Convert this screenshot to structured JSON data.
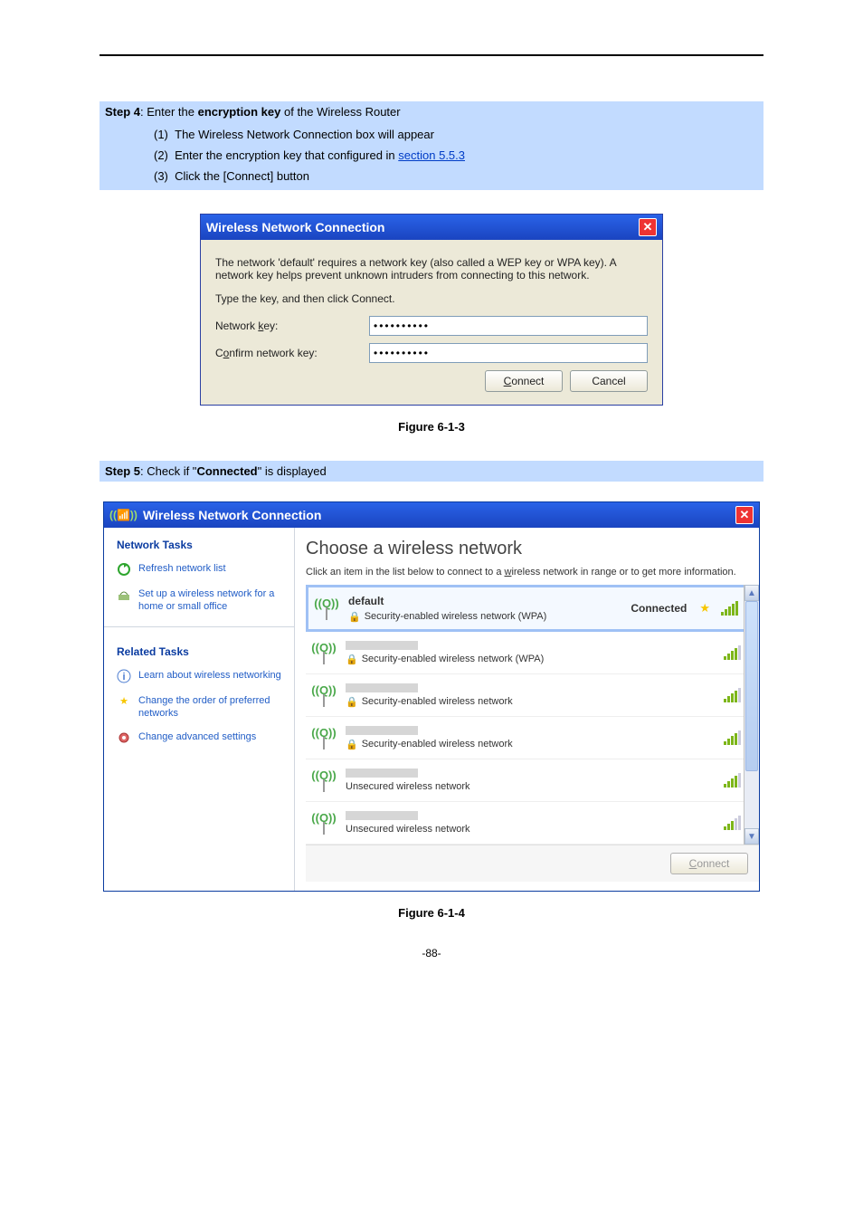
{
  "step4": {
    "label": "Step 4",
    "text_before": ": Enter the ",
    "bold": "encryption key",
    "text_after": " of the Wireless Router",
    "items": [
      {
        "n": "(1)",
        "t": "The Wireless Network Connection box will appear"
      },
      {
        "n": "(2)",
        "t": "Enter the encryption key that configured in ",
        "link": "section 5.5.3"
      },
      {
        "n": "(3)",
        "t": "Click the [Connect] button"
      }
    ]
  },
  "dlg1": {
    "title": "Wireless Network Connection",
    "desc": "The network 'default' requires a network key (also called a WEP key or WPA key). A network key helps prevent unknown intruders from connecting to this network.",
    "instr": "Type the key, and then click Connect.",
    "label_key": "Network key:",
    "label_key_ul": "k",
    "label_confirm": "Confirm network key:",
    "label_confirm_ul": "o",
    "key_value": "••••••••••",
    "confirm_value": "••••••••••",
    "btn_connect": "Connect",
    "btn_connect_ul": "C",
    "btn_cancel": "Cancel"
  },
  "figure1_caption": "Figure 6-1-3",
  "step5": {
    "label": "Step 5",
    "before": ": Check if \"",
    "bold": "Connected",
    "after": "\" is displayed"
  },
  "dlg2": {
    "title": "Wireless Network Connection",
    "sidebar": {
      "sec1": "Network Tasks",
      "tasks1": [
        {
          "icon": "refresh",
          "text": "Refresh network list"
        },
        {
          "icon": "setup",
          "text": "Set up a wireless network for a home or small office"
        }
      ],
      "sec2": "Related Tasks",
      "tasks2": [
        {
          "icon": "info",
          "text": "Learn about wireless networking"
        },
        {
          "icon": "star",
          "text": "Change the order of preferred networks"
        },
        {
          "icon": "gear",
          "text": "Change advanced settings"
        }
      ]
    },
    "heading": "Choose a wireless network",
    "sub_before": "Click an item in the list below to connect to a ",
    "sub_ul": "w",
    "sub_after": "ireless network in range or to get more information.",
    "connected_label": "Connected",
    "networks": [
      {
        "name": "default",
        "security": "Security-enabled wireless network (WPA)",
        "secure": true,
        "signal": 5,
        "connected": true
      },
      {
        "name": "",
        "security": "Security-enabled wireless network (WPA)",
        "secure": true,
        "signal": 4,
        "connected": false
      },
      {
        "name": "",
        "security": "Security-enabled wireless network",
        "secure": true,
        "signal": 4,
        "connected": false
      },
      {
        "name": "",
        "security": "Security-enabled wireless network",
        "secure": true,
        "signal": 4,
        "connected": false
      },
      {
        "name": "",
        "security": "Unsecured wireless network",
        "secure": false,
        "signal": 4,
        "connected": false
      },
      {
        "name": "",
        "security": "Unsecured wireless network",
        "secure": false,
        "signal": 3,
        "connected": false
      }
    ],
    "connect_btn": "Connect",
    "connect_btn_ul": "C"
  },
  "figure2_caption": "Figure 6-1-4",
  "page_number": "-88-"
}
